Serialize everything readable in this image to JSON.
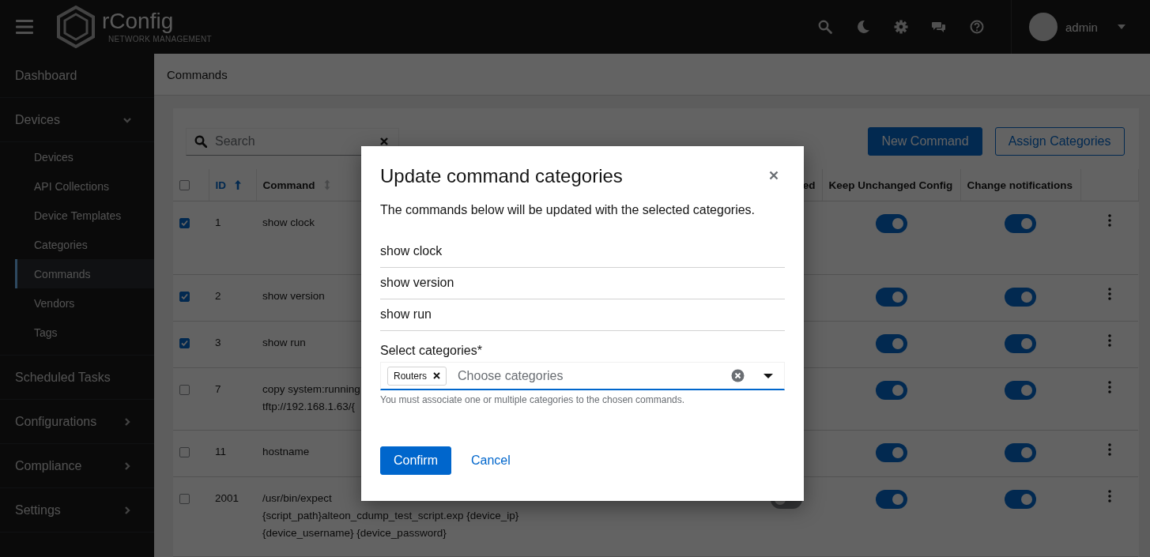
{
  "header": {
    "brand": "rConfig",
    "tagline": "NETWORK MANAGEMENT",
    "user": "admin"
  },
  "sidebar": {
    "items": [
      {
        "label": "Dashboard",
        "kind": "link"
      },
      {
        "label": "Devices",
        "kind": "group",
        "expanded": true,
        "children": [
          {
            "label": "Devices",
            "selected": false
          },
          {
            "label": "API Collections",
            "selected": false
          },
          {
            "label": "Device Templates",
            "selected": false
          },
          {
            "label": "Categories",
            "selected": false
          },
          {
            "label": "Commands",
            "selected": true
          },
          {
            "label": "Vendors",
            "selected": false
          },
          {
            "label": "Tags",
            "selected": false
          }
        ]
      },
      {
        "label": "Scheduled Tasks",
        "kind": "link"
      },
      {
        "label": "Configurations",
        "kind": "group",
        "expanded": false
      },
      {
        "label": "Compliance",
        "kind": "group",
        "expanded": false
      },
      {
        "label": "Settings",
        "kind": "group",
        "expanded": false
      }
    ]
  },
  "page_title": "Commands",
  "toolbar": {
    "search": {
      "placeholder": "Search"
    },
    "buttons": [
      {
        "label": "New Command",
        "kind": "primary"
      },
      {
        "label": "Assign Categories",
        "kind": "secondary"
      }
    ]
  },
  "table": {
    "select_all_checked": false,
    "columns": [
      {
        "label": "ID",
        "sorted": true
      },
      {
        "label": "Command",
        "sorted": false
      },
      {
        "label": "ed"
      },
      {
        "label": "Keep Unchanged Config"
      },
      {
        "label": "Change notifications"
      }
    ],
    "rows": [
      {
        "checked": true,
        "id": "1",
        "command_lines": [
          "show clock"
        ],
        "keep_unchanged_config": true,
        "change_notifications": true
      },
      {
        "checked": true,
        "id": "2",
        "command_lines": [
          "show version"
        ],
        "keep_unchanged_config": true,
        "change_notifications": true
      },
      {
        "checked": true,
        "id": "3",
        "command_lines": [
          "show run"
        ],
        "keep_unchanged_config": true,
        "change_notifications": true
      },
      {
        "checked": false,
        "id": "7",
        "command_lines": [
          "copy system:running",
          "tftp://192.168.1.63/{"
        ],
        "keep_unchanged_config": true,
        "change_notifications": true
      },
      {
        "checked": false,
        "id": "11",
        "command_lines": [
          "hostname"
        ],
        "keep_unchanged_config": true,
        "change_notifications": true
      },
      {
        "checked": false,
        "id": "2001",
        "command_lines": [
          "/usr/bin/expect",
          "{script_path}alteon_cdump_test_script.exp {device_ip}",
          "{device_username} {device_password}"
        ],
        "column_3_on": false,
        "keep_unchanged_config": true,
        "change_notifications": true
      }
    ]
  },
  "modal": {
    "title": "Update command categories",
    "description": "The commands below will be updated with the selected categories.",
    "commands": [
      "show clock",
      "show version",
      "show run"
    ],
    "field": {
      "label": "Select categories*",
      "chips": [
        "Routers"
      ],
      "placeholder": "Choose categories",
      "helper": "You must associate one or multiple categories to the chosen commands."
    },
    "buttons": [
      {
        "label": "Confirm",
        "kind": "primary"
      },
      {
        "label": "Cancel",
        "kind": "link"
      }
    ]
  }
}
